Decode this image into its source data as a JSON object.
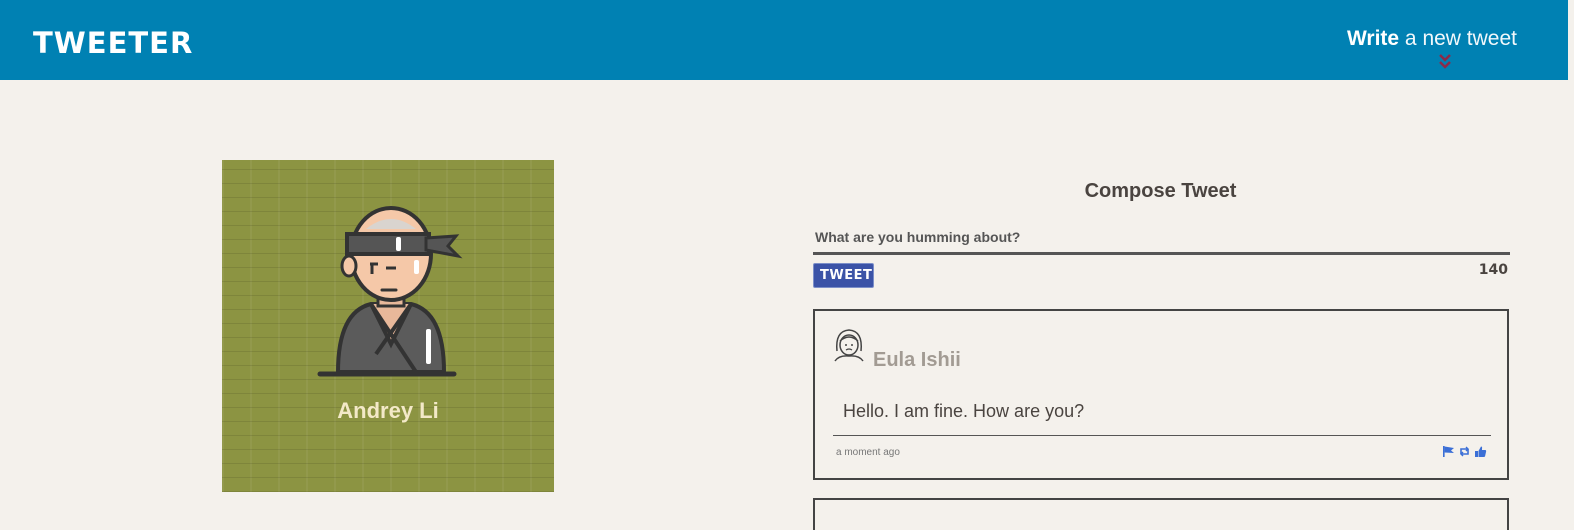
{
  "header": {
    "brand": "TWEETER",
    "write_strong": "Write",
    "write_rest": " a new tweet",
    "background": "#0081b3"
  },
  "profile": {
    "name": "Andrey Li",
    "avatar_icon": "ninja-avatar-icon"
  },
  "compose": {
    "title": "Compose Tweet",
    "placeholder": "What are you humming about?",
    "button_label": "TWEET",
    "counter": "140",
    "button_color": "#3b53a7"
  },
  "tweets": [
    {
      "author": "Eula Ishii",
      "content": "Hello. I am fine. How are you?",
      "time": "a moment ago",
      "avatar_icon": "user-avatar-icon",
      "actions": [
        "flag-icon",
        "retweet-icon",
        "like-icon"
      ]
    }
  ]
}
